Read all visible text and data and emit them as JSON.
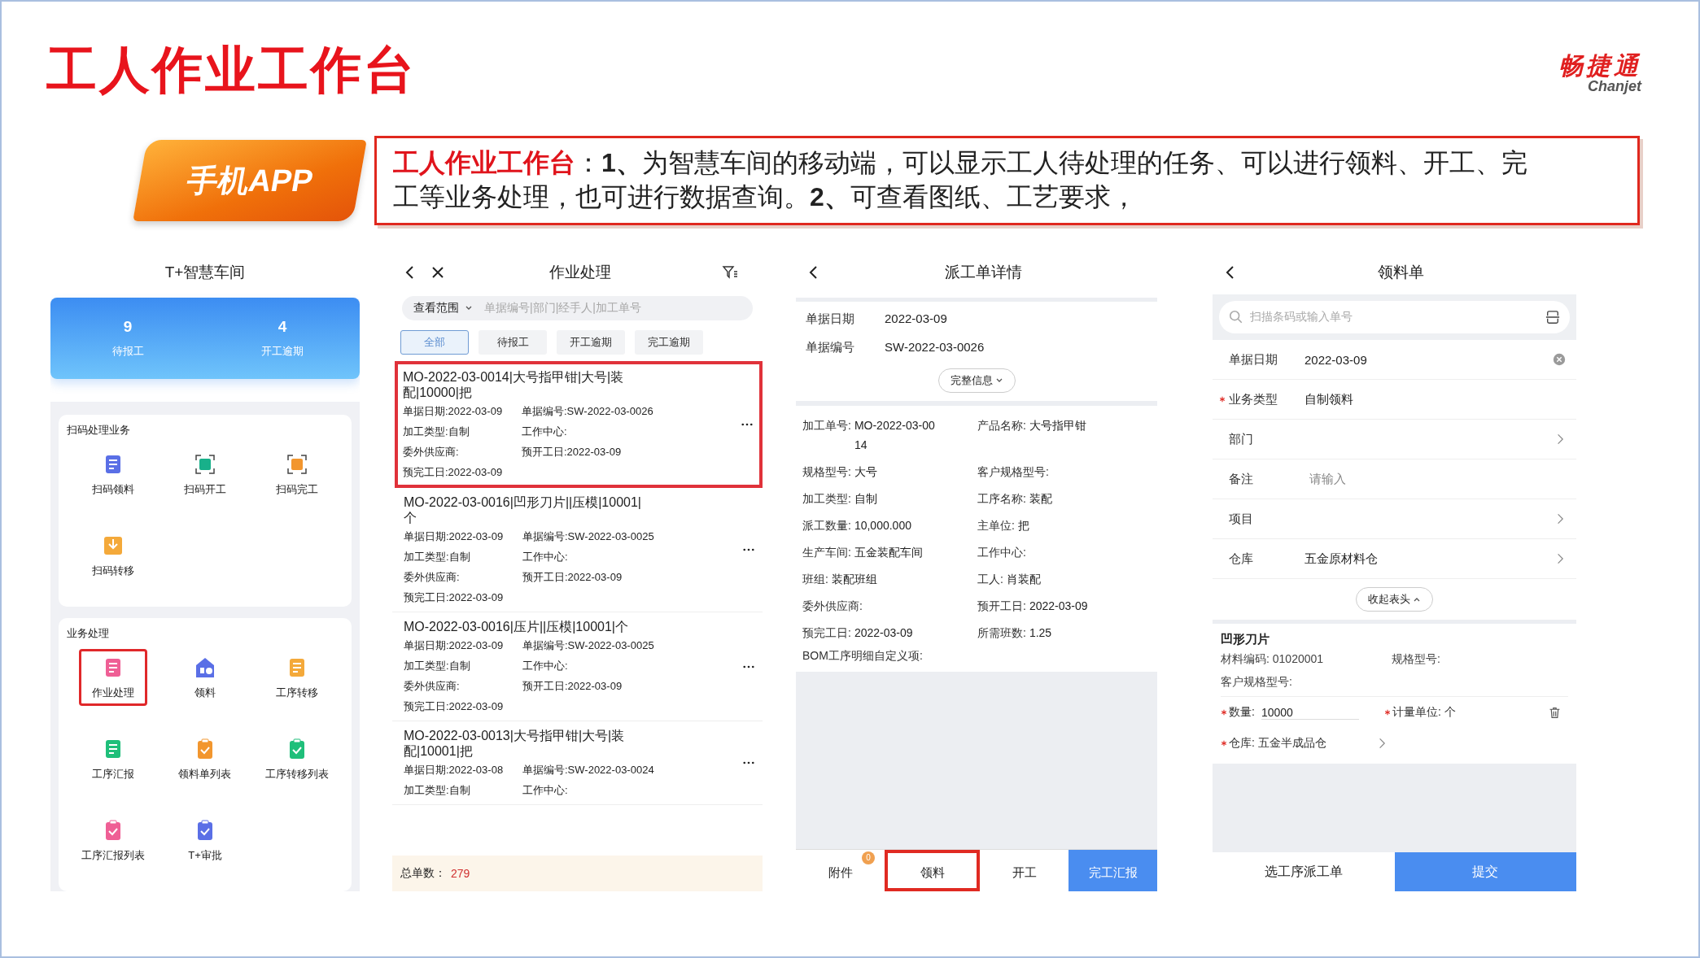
{
  "slide": {
    "title": "工人作业工作台",
    "logo": {
      "name": "畅捷通",
      "latin": "Chanjet"
    },
    "tag": "手机APP",
    "description": {
      "lead": "工人作业工作台",
      "body": "：**1、**为智慧车间的移动端，可以显示工人待处理的任务、可以进行领料、开工、完工等业务处理，也可进行数据查询。**2、**可查看图纸、工艺要求，"
    }
  },
  "home": {
    "title": "T+智慧车间",
    "stats": [
      {
        "value": "9",
        "label": "待报工"
      },
      {
        "value": "4",
        "label": "开工逾期"
      }
    ],
    "sections": [
      {
        "title": "扫码处理业务",
        "items": [
          {
            "label": "扫码领料",
            "highlighted": false
          },
          {
            "label": "扫码开工",
            "highlighted": false
          },
          {
            "label": "扫码完工",
            "highlighted": false
          },
          {
            "label": "扫码转移",
            "highlighted": false
          }
        ]
      },
      {
        "title": "业务处理",
        "items": [
          {
            "label": "作业处理",
            "highlighted": true
          },
          {
            "label": "领料",
            "highlighted": false
          },
          {
            "label": "工序转移",
            "highlighted": false
          },
          {
            "label": "工序汇报",
            "highlighted": false
          },
          {
            "label": "领料单列表",
            "highlighted": false
          },
          {
            "label": "工序转移列表",
            "highlighted": false
          },
          {
            "label": "工序汇报列表",
            "highlighted": false
          },
          {
            "label": "T+审批",
            "highlighted": false
          }
        ]
      }
    ]
  },
  "orders_screen": {
    "title": "作业处理",
    "scope": "查看范围",
    "search_placeholder": "单据编号|部门|经手人|加工单号",
    "filters": [
      {
        "label": "全部",
        "selected": true
      },
      {
        "label": "待报工",
        "selected": false
      },
      {
        "label": "开工逾期",
        "selected": false
      },
      {
        "label": "完工逾期",
        "selected": false
      }
    ],
    "orders": [
      {
        "title": "MO-2022-03-0014|大号指甲钳|大号|装配|10000|把",
        "highlighted": true,
        "fields": [
          "单据日期:2022-03-09",
          "单据编号:SW-2022-03-0026",
          "加工类型:自制",
          "工作中心:",
          "委外供应商:",
          "预开工日:2022-03-09",
          "预完工日:2022-03-09"
        ]
      },
      {
        "title": "MO-2022-03-0016|凹形刀片||压模|10001|个",
        "highlighted": false,
        "fields": [
          "单据日期:2022-03-09",
          "单据编号:SW-2022-03-0025",
          "加工类型:自制",
          "工作中心:",
          "委外供应商:",
          "预开工日:2022-03-09",
          "预完工日:2022-03-09"
        ]
      },
      {
        "title": "MO-2022-03-0016|压片||压模|10001|个",
        "highlighted": false,
        "fields": [
          "单据日期:2022-03-09",
          "单据编号:SW-2022-03-0025",
          "加工类型:自制",
          "工作中心:",
          "委外供应商:",
          "预开工日:2022-03-09",
          "预完工日:2022-03-09"
        ]
      },
      {
        "title": "MO-2022-03-0013|大号指甲钳|大号|装配|10001|把",
        "highlighted": false,
        "fields": [
          "单据日期:2022-03-08",
          "单据编号:SW-2022-03-0024",
          "加工类型:自制",
          "工作中心:"
        ]
      }
    ],
    "total_label": "总单数：",
    "total": "279"
  },
  "detail_screen": {
    "title": "派工单详情",
    "header_fields": [
      {
        "label": "单据日期",
        "value": "2022-03-09"
      },
      {
        "label": "单据编号",
        "value": "SW-2022-03-0026"
      }
    ],
    "more": "完整信息",
    "fields": [
      {
        "label": "加工单号:",
        "value": "MO-2022-03-0014"
      },
      {
        "label": "产品名称:",
        "value": "大号指甲钳"
      },
      {
        "label": "规格型号:",
        "value": "大号"
      },
      {
        "label": "客户规格型号:"
      },
      {
        "label": "加工类型:",
        "value": "自制"
      },
      {
        "label": "工序名称:",
        "value": "装配"
      },
      {
        "label": "派工数量:",
        "value": "10,000.000"
      },
      {
        "label": "主单位:",
        "value": "把"
      },
      {
        "label": "生产车间:",
        "value": "五金装配车间"
      },
      {
        "label": "工作中心:"
      },
      {
        "label": "班组:",
        "value": "装配班组"
      },
      {
        "label": "工人:",
        "value": "肖装配"
      },
      {
        "label": "委外供应商:"
      },
      {
        "label": "预开工日:",
        "value": "2022-03-09"
      },
      {
        "label": "预完工日:",
        "value": "2022-03-09"
      },
      {
        "label": "所需班数:",
        "value": "1.25"
      }
    ],
    "custom_label": "BOM工序明细自定义项:",
    "actions": [
      {
        "label": "附件",
        "kind": "plain",
        "badge": "0",
        "highlighted": false
      },
      {
        "label": "领料",
        "kind": "plain",
        "highlighted": true
      },
      {
        "label": "开工",
        "kind": "plain",
        "highlighted": false
      },
      {
        "label": "完工汇报",
        "kind": "primary",
        "highlighted": false
      }
    ]
  },
  "requisition_screen": {
    "title": "领料单",
    "search_placeholder": "扫描条码或输入单号",
    "rows": [
      {
        "label": "单据日期",
        "value": "2022-03-09",
        "kind": "clear",
        "required": false
      },
      {
        "label": "业务类型",
        "value": "自制领料",
        "kind": "text",
        "required": true
      },
      {
        "label": "部门",
        "kind": "link",
        "required": false
      },
      {
        "label": "备注",
        "placeholder": "请输入",
        "kind": "input",
        "required": false
      },
      {
        "label": "项目",
        "kind": "link",
        "required": false
      },
      {
        "label": "仓库",
        "value": "五金原材料仓",
        "kind": "link",
        "required": false
      }
    ],
    "collapse": "收起表头",
    "item": {
      "name": "凹形刀片",
      "fields": [
        "材料编码: 01020001",
        "规格型号:",
        "客户规格型号:"
      ],
      "quantity": {
        "label": "数量:",
        "value": "10000",
        "required": true
      },
      "unit": {
        "label": "计量单位: 个",
        "required": true
      },
      "warehouse": {
        "label": "仓库: 五金半成品仓",
        "required": true
      }
    },
    "buttons": [
      {
        "label": "选工序派工单",
        "kind": "secondary"
      },
      {
        "label": "提交",
        "kind": "primary"
      }
    ]
  }
}
